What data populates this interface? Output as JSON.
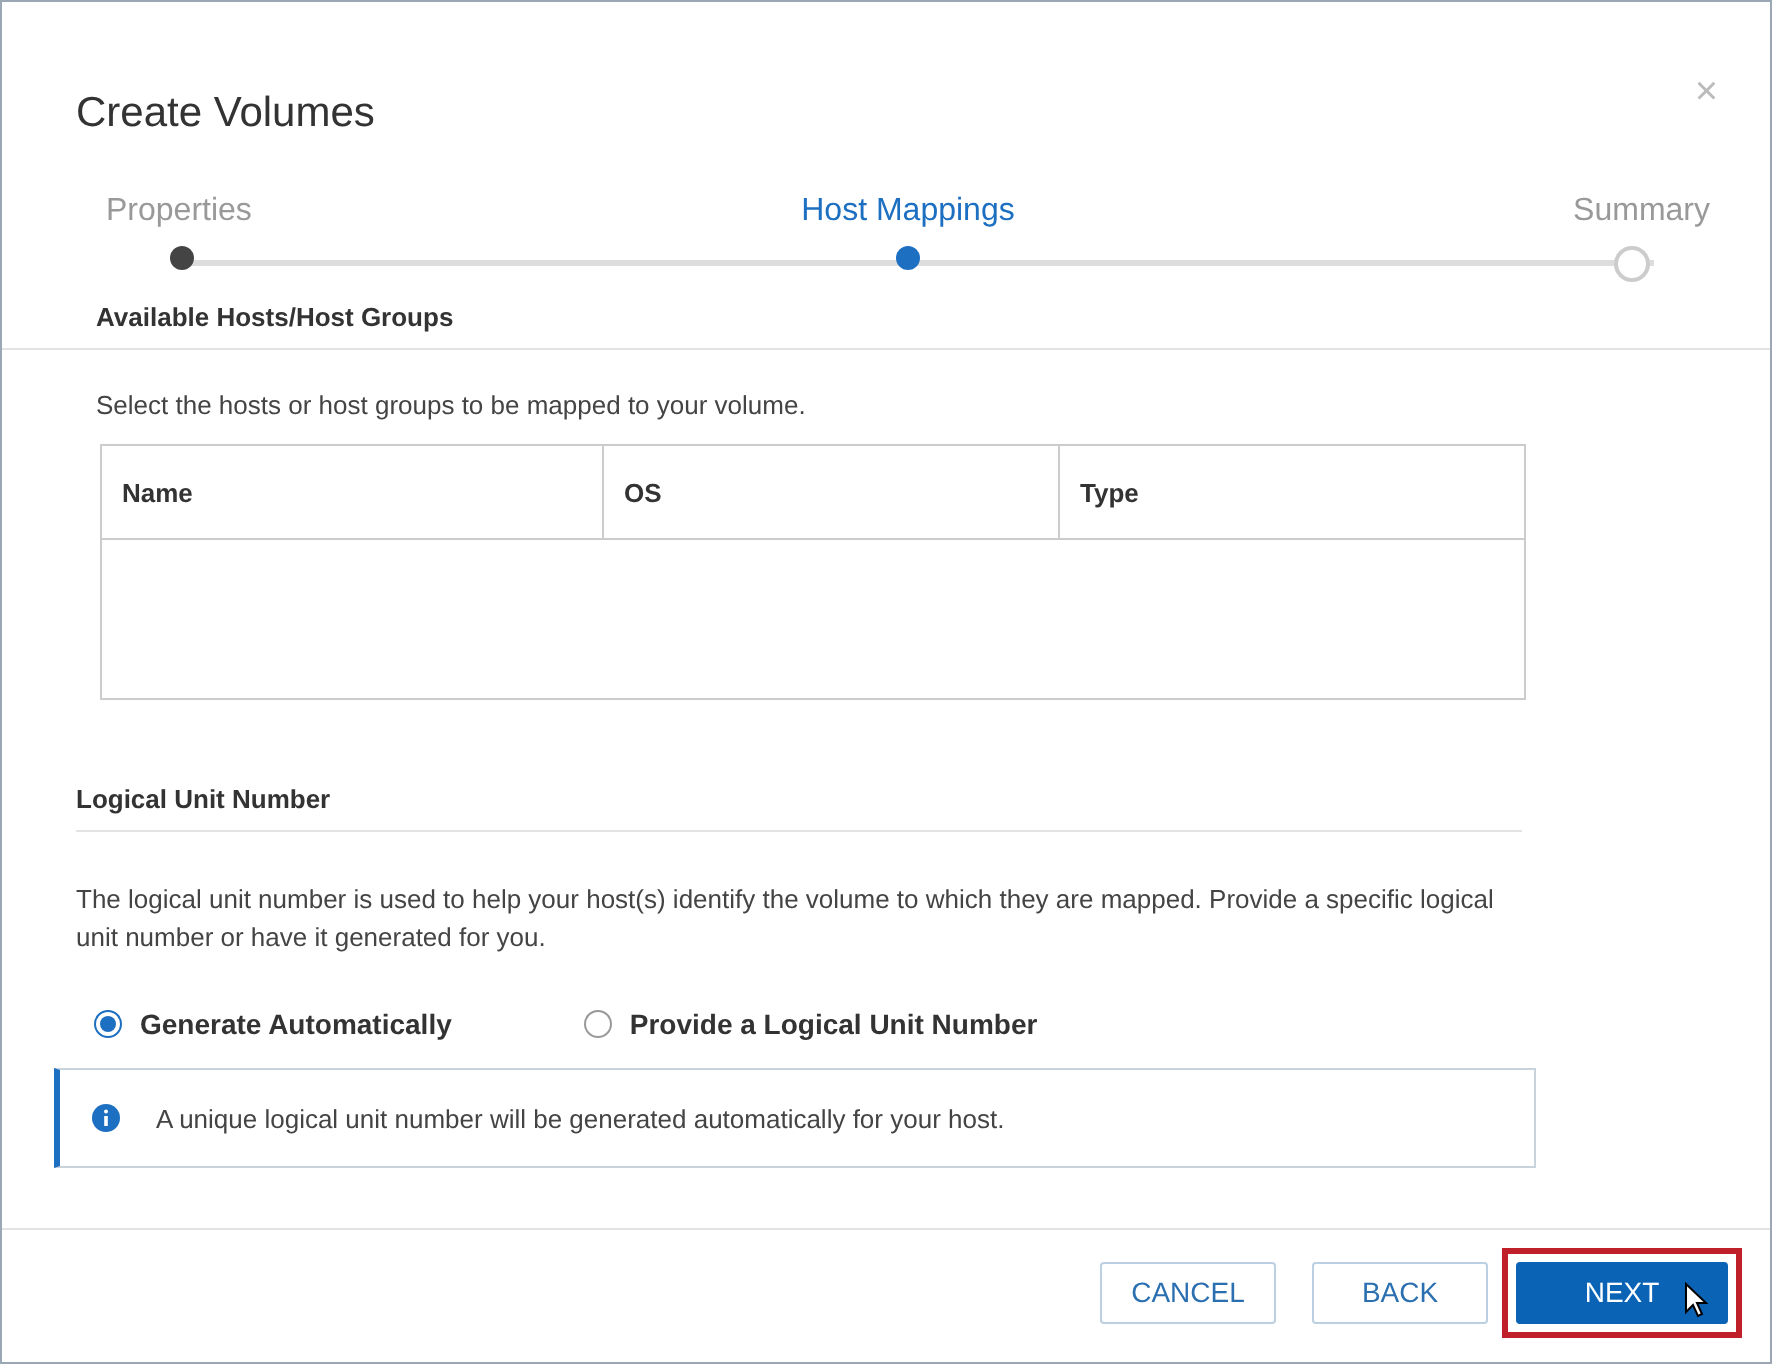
{
  "dialog": {
    "title": "Create Volumes",
    "close": "×"
  },
  "steps": [
    {
      "label": "Properties",
      "kind": "done"
    },
    {
      "label": "Host Mappings",
      "kind": "current"
    },
    {
      "label": "Summary",
      "kind": "pending"
    }
  ],
  "hosts_section": {
    "heading": "Available Hosts/Host Groups",
    "description": "Select the hosts or host groups to be mapped to your volume.",
    "table": {
      "columns": [
        "Name",
        "OS",
        "Type"
      ]
    }
  },
  "lun_section": {
    "heading": "Logical Unit Number",
    "description": "The logical unit number is used to help your host(s) identify the volume to which they are mapped. Provide a specific logical unit number or have it generated for you.",
    "options": [
      {
        "label": "Generate Automatically",
        "selected": true
      },
      {
        "label": "Provide a Logical Unit Number",
        "selected": false
      }
    ],
    "info": "A unique logical unit number will be generated automatically for your host."
  },
  "buttons": [
    {
      "label": "CANCEL",
      "kind": "secondary",
      "highlighted": false
    },
    {
      "label": "BACK",
      "kind": "secondary",
      "highlighted": false
    },
    {
      "label": "NEXT",
      "kind": "primary",
      "highlighted": true
    }
  ]
}
